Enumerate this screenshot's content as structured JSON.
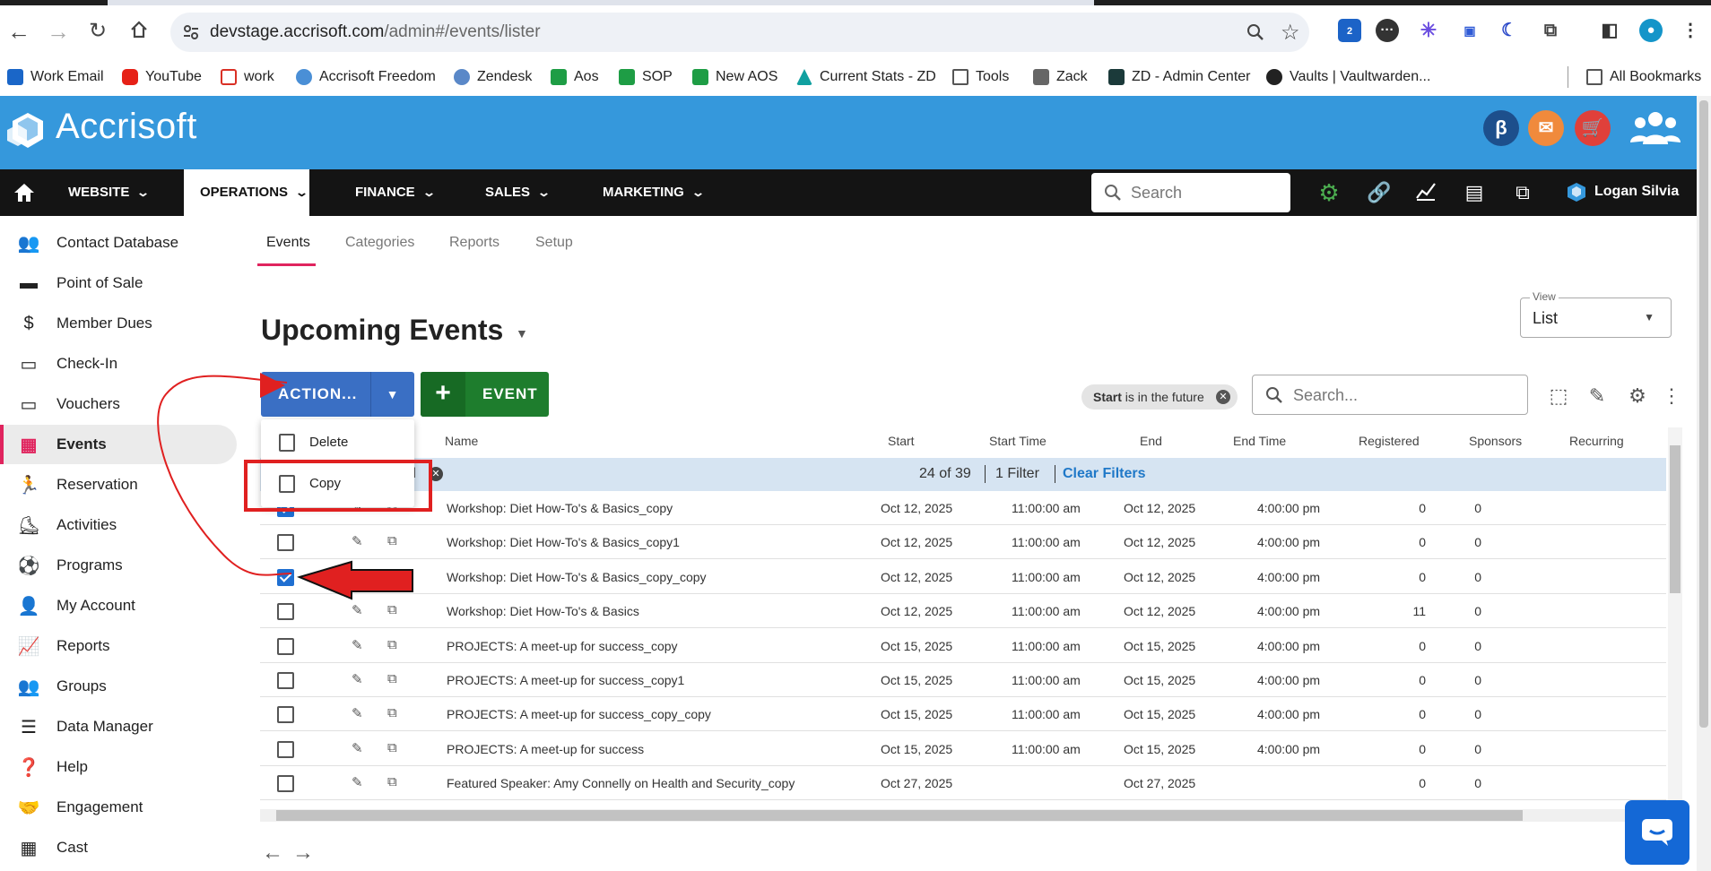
{
  "browser": {
    "url_host": "devstage.accrisoft.com",
    "url_path": "/admin#/events/lister",
    "ext_badge": "2",
    "bookmarks": [
      "Work Email",
      "YouTube",
      "work",
      "Accrisoft Freedom",
      "Zendesk",
      "Aos",
      "SOP",
      "New AOS",
      "Current Stats - ZD",
      "Tools",
      "Zack",
      "ZD - Admin Center",
      "Vaults | Vaultwarden...",
      "All Bookmarks"
    ]
  },
  "header": {
    "logo": "Accrisoft",
    "beta_icon": "β"
  },
  "topnav": {
    "items": [
      "WEBSITE",
      "OPERATIONS",
      "FINANCE",
      "SALES",
      "MARKETING"
    ],
    "search_placeholder": "Search",
    "user": "Logan Silvia"
  },
  "sidebar": {
    "items": [
      "Contact Database",
      "Point of Sale",
      "Member Dues",
      "Check-In",
      "Vouchers",
      "Events",
      "Reservation",
      "Activities",
      "Programs",
      "My Account",
      "Reports",
      "Groups",
      "Data Manager",
      "Help",
      "Engagement",
      "Cast"
    ],
    "active": "Events"
  },
  "tabs": [
    "Events",
    "Categories",
    "Reports",
    "Setup"
  ],
  "page": {
    "title": "Upcoming Events",
    "view_label": "View",
    "view_value": "List",
    "action_button": "ACTION...",
    "event_button": "EVENT",
    "filter_chip_field": "Start",
    "filter_chip_rest": "is in the future",
    "search_placeholder": "Search..."
  },
  "action_menu": [
    "Delete",
    "Copy"
  ],
  "table": {
    "columns": [
      "Name",
      "Start",
      "Start Time",
      "End",
      "End Time",
      "Registered",
      "Sponsors",
      "Recurring"
    ],
    "summary": {
      "selected_fragment": "d",
      "count": "24 of 39",
      "filters": "1 Filter",
      "clear": "Clear Filters"
    },
    "rows": [
      {
        "checked": true,
        "name": "Workshop: Diet How-To's & Basics_copy",
        "start": "Oct 12, 2025",
        "start_time": "11:00:00 am",
        "end": "Oct 12, 2025",
        "end_time": "4:00:00 pm",
        "registered": "0",
        "sponsors": "0"
      },
      {
        "checked": false,
        "name": "Workshop: Diet How-To's & Basics_copy1",
        "start": "Oct 12, 2025",
        "start_time": "11:00:00 am",
        "end": "Oct 12, 2025",
        "end_time": "4:00:00 pm",
        "registered": "0",
        "sponsors": "0"
      },
      {
        "checked": true,
        "name": "Workshop: Diet How-To's & Basics_copy_copy",
        "start": "Oct 12, 2025",
        "start_time": "11:00:00 am",
        "end": "Oct 12, 2025",
        "end_time": "4:00:00 pm",
        "registered": "0",
        "sponsors": "0"
      },
      {
        "checked": false,
        "name": "Workshop: Diet How-To's & Basics",
        "start": "Oct 12, 2025",
        "start_time": "11:00:00 am",
        "end": "Oct 12, 2025",
        "end_time": "4:00:00 pm",
        "registered": "11",
        "sponsors": "0"
      },
      {
        "checked": false,
        "name": "PROJECTS: A meet-up for success_copy",
        "start": "Oct 15, 2025",
        "start_time": "11:00:00 am",
        "end": "Oct 15, 2025",
        "end_time": "4:00:00 pm",
        "registered": "0",
        "sponsors": "0"
      },
      {
        "checked": false,
        "name": "PROJECTS: A meet-up for success_copy1",
        "start": "Oct 15, 2025",
        "start_time": "11:00:00 am",
        "end": "Oct 15, 2025",
        "end_time": "4:00:00 pm",
        "registered": "0",
        "sponsors": "0"
      },
      {
        "checked": false,
        "name": "PROJECTS: A meet-up for success_copy_copy",
        "start": "Oct 15, 2025",
        "start_time": "11:00:00 am",
        "end": "Oct 15, 2025",
        "end_time": "4:00:00 pm",
        "registered": "0",
        "sponsors": "0"
      },
      {
        "checked": false,
        "name": "PROJECTS: A meet-up for success",
        "start": "Oct 15, 2025",
        "start_time": "11:00:00 am",
        "end": "Oct 15, 2025",
        "end_time": "4:00:00 pm",
        "registered": "0",
        "sponsors": "0"
      },
      {
        "checked": false,
        "name": "Featured Speaker: Amy Connelly on Health and Security_copy",
        "start": "Oct 27, 2025",
        "start_time": "",
        "end": "Oct 27, 2025",
        "end_time": "",
        "registered": "0",
        "sponsors": "0"
      }
    ]
  },
  "colors": {
    "header_blue": "#3598dc",
    "nav_black": "#141414",
    "accent_pink": "#e0245e",
    "action_blue": "#3a6fc4",
    "event_green": "#1e7d2d",
    "annotation_red": "#e02020"
  }
}
